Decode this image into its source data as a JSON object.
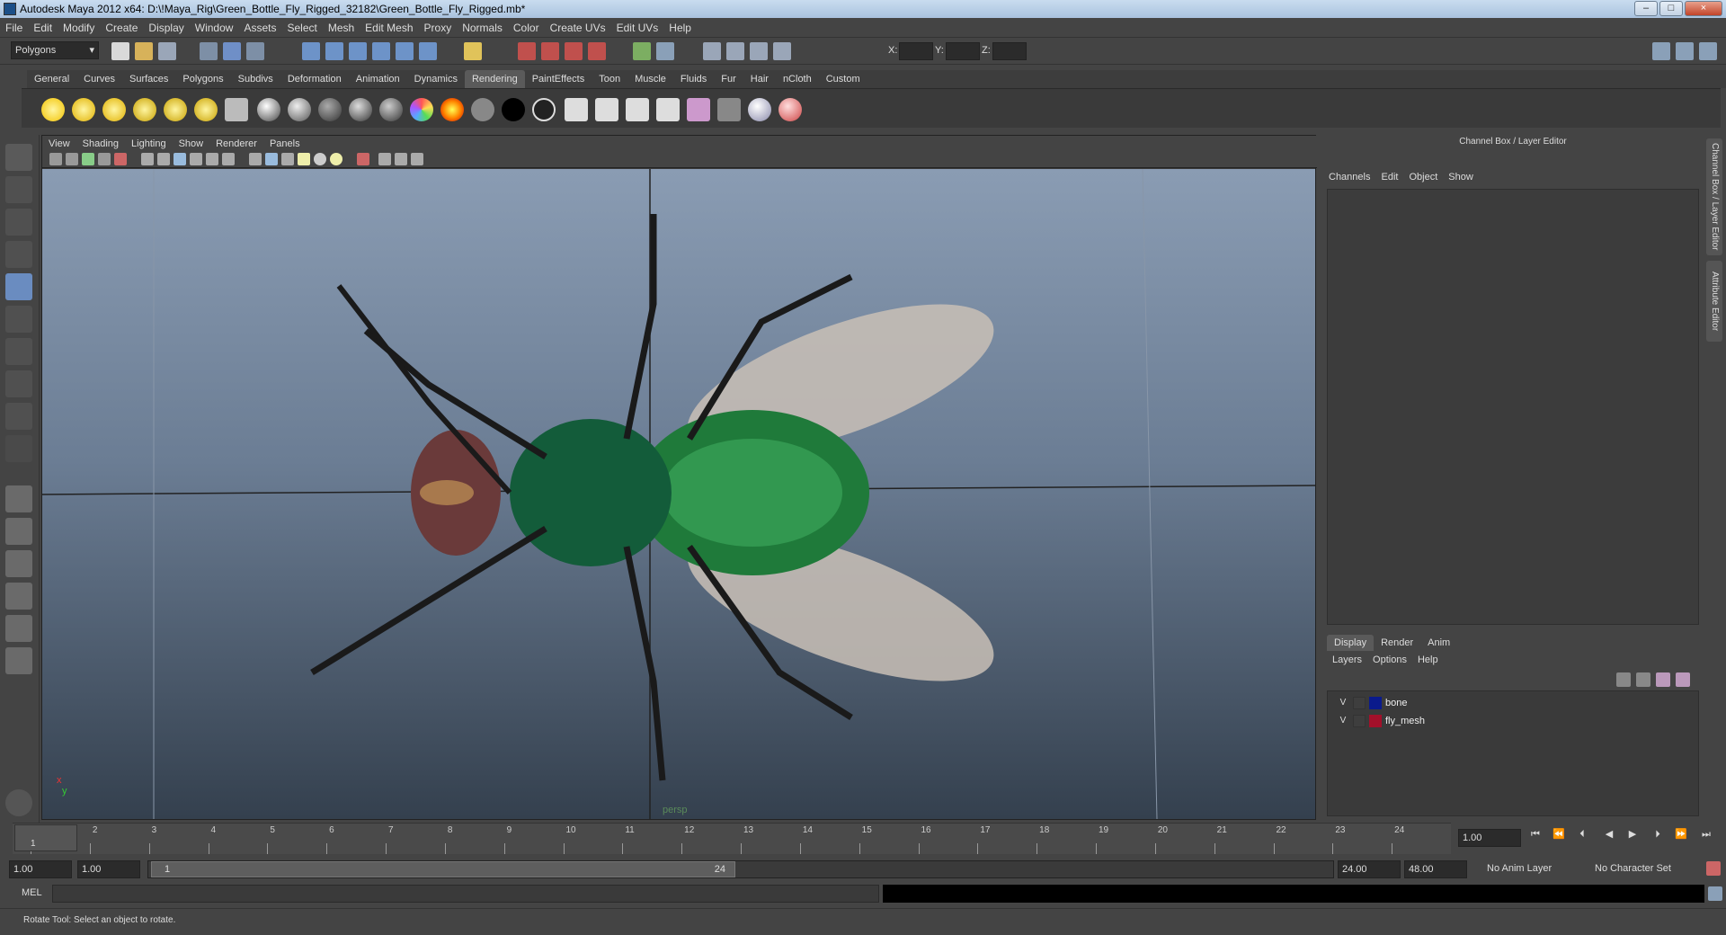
{
  "window": {
    "title": "Autodesk Maya 2012 x64: D:\\!Maya_Rig\\Green_Bottle_Fly_Rigged_32182\\Green_Bottle_Fly_Rigged.mb*",
    "minimize": "–",
    "maximize": "□",
    "close": "×"
  },
  "menubar": [
    "File",
    "Edit",
    "Modify",
    "Create",
    "Display",
    "Window",
    "Assets",
    "Select",
    "Mesh",
    "Edit Mesh",
    "Proxy",
    "Normals",
    "Color",
    "Create UVs",
    "Edit UVs",
    "Help"
  ],
  "statusline": {
    "mode": "Polygons",
    "x_label": "X:",
    "y_label": "Y:",
    "z_label": "Z:"
  },
  "shelf": {
    "tabs": [
      "General",
      "Curves",
      "Surfaces",
      "Polygons",
      "Subdivs",
      "Deformation",
      "Animation",
      "Dynamics",
      "Rendering",
      "PaintEffects",
      "Toon",
      "Muscle",
      "Fluids",
      "Fur",
      "Hair",
      "nCloth",
      "Custom"
    ],
    "active": "Rendering"
  },
  "viewport": {
    "menu": [
      "View",
      "Shading",
      "Lighting",
      "Show",
      "Renderer",
      "Panels"
    ],
    "camera": "persp",
    "axis_x": "x",
    "axis_y": "y"
  },
  "channelbox": {
    "title": "Channel Box / Layer Editor",
    "menu": [
      "Channels",
      "Edit",
      "Object",
      "Show"
    ]
  },
  "sidetabs": {
    "channel": "Channel Box / Layer Editor",
    "attribute": "Attribute Editor"
  },
  "layereditor": {
    "tabs": [
      "Display",
      "Render",
      "Anim"
    ],
    "active": "Display",
    "menu": [
      "Layers",
      "Options",
      "Help"
    ],
    "layers": [
      {
        "visible": "V",
        "name": "bone",
        "color": "#0a1a8c"
      },
      {
        "visible": "V",
        "name": "fly_mesh",
        "color": "#a3102a"
      }
    ]
  },
  "timeslider": {
    "ticks": [
      "1",
      "2",
      "3",
      "4",
      "5",
      "6",
      "7",
      "8",
      "9",
      "10",
      "11",
      "12",
      "13",
      "14",
      "15",
      "16",
      "17",
      "18",
      "19",
      "20",
      "21",
      "22",
      "23",
      "24"
    ],
    "current_frame": "1",
    "current_field": "1.00"
  },
  "range": {
    "start": "1.00",
    "start2": "1.00",
    "range_start": "1",
    "range_end": "24",
    "end": "24.00",
    "end2": "48.00",
    "anim_layer": "No Anim Layer",
    "char_set": "No Character Set"
  },
  "cmdline": {
    "label": "MEL"
  },
  "helpline": "Rotate Tool: Select an object to rotate."
}
